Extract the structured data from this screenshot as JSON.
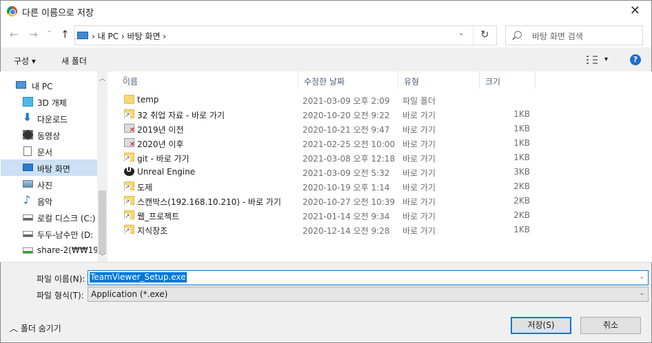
{
  "window": {
    "title": "다른 이름으로 저장",
    "close": "✕"
  },
  "nav": {
    "back": "←",
    "forward": "→",
    "dropdown": "⌄",
    "up": "↑",
    "path": "› 내 PC › 바탕 화면 ›",
    "path_dropdown": "⌄",
    "refresh": "↻",
    "search_placeholder": "바탕 화면 검색"
  },
  "toolbar": {
    "organize": "구성 ▾",
    "new_folder": "새 폴더",
    "view_menu": "▾",
    "help": "?"
  },
  "sidebar": [
    {
      "label": "내 PC",
      "icon": "pc-icon"
    },
    {
      "label": "3D 개체",
      "icon": "cube-icon"
    },
    {
      "label": "다운로드",
      "icon": "download-arrow-icon"
    },
    {
      "label": "동영상",
      "icon": "film-icon"
    },
    {
      "label": "문서",
      "icon": "document-icon"
    },
    {
      "label": "바탕 화면",
      "icon": "desktop-icon",
      "selected": true
    },
    {
      "label": "사진",
      "icon": "picture-icon"
    },
    {
      "label": "음악",
      "icon": "music-note-icon"
    },
    {
      "label": "로컬 디스크 (C:)",
      "icon": "drive-icon"
    },
    {
      "label": "두두-남수만 (D:",
      "icon": "drive-icon"
    },
    {
      "label": "share-2(₩₩192.",
      "icon": "network-drive-icon"
    }
  ],
  "scroll": {
    "up": "︿",
    "down": "﹀"
  },
  "columns": {
    "name": "이름",
    "date": "수정한 날짜",
    "type": "유형",
    "size": "크기",
    "sort": "^"
  },
  "files": [
    {
      "name": "temp",
      "date": "2021-03-09 오후 2:09",
      "type": "파일 폴더",
      "size": "",
      "icon": "folder"
    },
    {
      "name": "32 취업 자료 - 바로 가기",
      "date": "2020-10-20 오전 9:22",
      "type": "바로 가기",
      "size": "1KB",
      "icon": "shortcut"
    },
    {
      "name": "2019년 이전",
      "date": "2020-10-21 오전 9:47",
      "type": "바로 가기",
      "size": "1KB",
      "icon": "redx"
    },
    {
      "name": "2020년 이후",
      "date": "2021-02-25 오전 10:00",
      "type": "바로 가기",
      "size": "1KB",
      "icon": "redx"
    },
    {
      "name": "git - 바로 가기",
      "date": "2021-03-08 오후 12:18",
      "type": "바로 가기",
      "size": "1KB",
      "icon": "shortcut"
    },
    {
      "name": "Unreal Engine",
      "date": "2021-03-09 오전 5:32",
      "type": "바로 가기",
      "size": "3KB",
      "icon": "ue"
    },
    {
      "name": "도제",
      "date": "2020-10-19 오후 1:14",
      "type": "바로 가기",
      "size": "2KB",
      "icon": "shortcut"
    },
    {
      "name": "스캔박스(192.168.10.210) - 바로 가기",
      "date": "2020-10-27 오전 10:39",
      "type": "바로 가기",
      "size": "2KB",
      "icon": "shortcut"
    },
    {
      "name": "웹_프로젝트",
      "date": "2021-01-14 오전 9:34",
      "type": "바로 가기",
      "size": "2KB",
      "icon": "shortcut"
    },
    {
      "name": "지식창조",
      "date": "2020-12-14 오전 9:28",
      "type": "바로 가기",
      "size": "1KB",
      "icon": "shortcut"
    }
  ],
  "bottom": {
    "filename_label": "파일 이름(N):",
    "filename_value": "TeamViewer_Setup.exe",
    "filetype_label": "파일 형식(T):",
    "filetype_value": "Application (*.exe)",
    "combo_arrow": "⌄",
    "hide_folders": "︿  폴더 숨기기",
    "save": "저장(S)",
    "cancel": "취소"
  }
}
